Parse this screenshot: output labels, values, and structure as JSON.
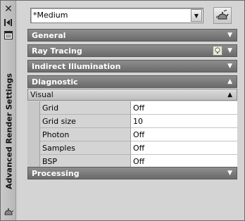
{
  "palette": {
    "title": "Advanced Render Settings",
    "close_glyph": "✕"
  },
  "preset": {
    "value": "*Medium",
    "arrow_glyph": "▼"
  },
  "sections": {
    "general": {
      "label": "General",
      "chevron": "▼"
    },
    "ray_tracing": {
      "label": "Ray Tracing",
      "chevron": "▼"
    },
    "indirect": {
      "label": "Indirect Illumination",
      "chevron": "▼"
    },
    "diagnostic": {
      "label": "Diagnostic",
      "chevron": "▲"
    },
    "visual": {
      "label": "Visual",
      "chevron": "▲"
    },
    "processing": {
      "label": "Processing",
      "chevron": "▼"
    }
  },
  "properties": [
    {
      "name": "Grid",
      "value": "Off"
    },
    {
      "name": "Grid size",
      "value": "10"
    },
    {
      "name": "Photon",
      "value": "Off"
    },
    {
      "name": "Samples",
      "value": "Off"
    },
    {
      "name": "BSP",
      "value": "Off"
    }
  ],
  "icons": {
    "close": "close-icon",
    "autohide": "autohide-icon",
    "properties": "properties-icon",
    "render": "render-teapot-icon",
    "lamp": "lamp-icon",
    "palette_menu": "palette-menu-icon"
  }
}
